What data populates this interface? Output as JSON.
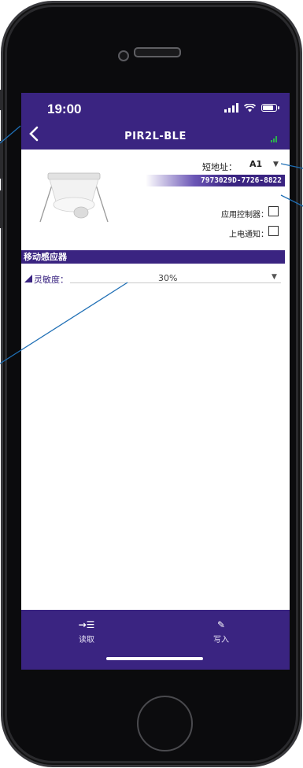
{
  "status": {
    "time": "19:00"
  },
  "header": {
    "back_icon": "chevron-left-icon",
    "title": "PIR2L-BLE"
  },
  "device": {
    "short_address_label": "短地址：",
    "short_address_value": "A1",
    "serial": "7973029D-7726-8822",
    "app_controller_label": "应用控制器：",
    "power_on_notify_label": "上电通知："
  },
  "section": {
    "title": "移动感应器"
  },
  "sensitivity": {
    "label": "灵敏度：",
    "value": "30%"
  },
  "toolbar": {
    "read_label": "读取",
    "read_icon": "→☰",
    "write_label": "写入",
    "write_icon": "✎"
  },
  "colors": {
    "brand": "#3a2481",
    "signal": "#2bb24c",
    "callout": "#1f6fb5"
  }
}
